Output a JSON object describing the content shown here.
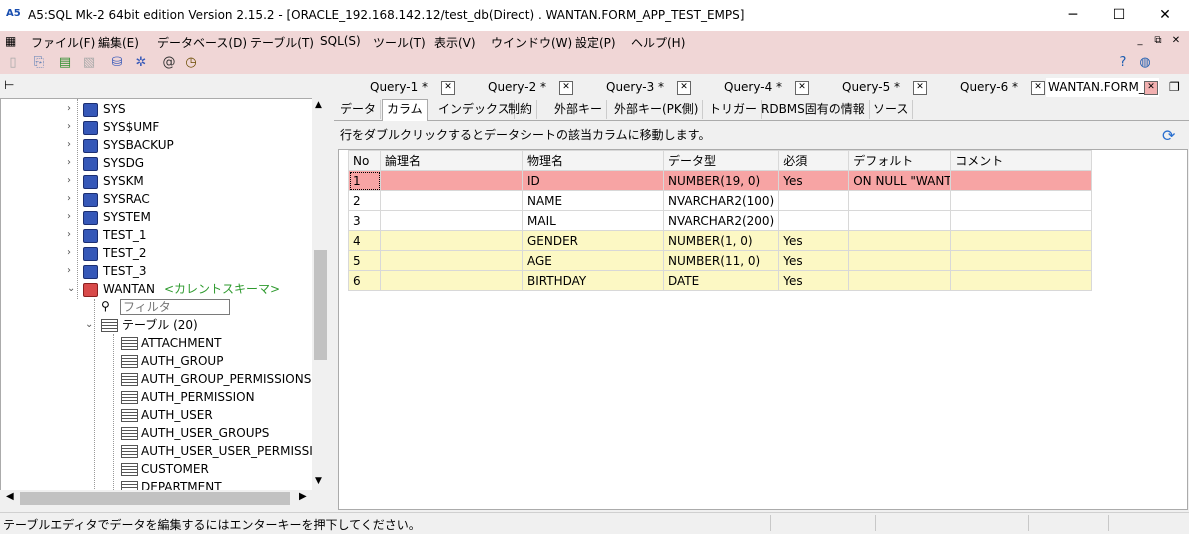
{
  "window": {
    "title": "A5:SQL Mk-2 64bit edition Version 2.15.2 - [ORACLE_192.168.142.12/test_db(Direct) . WANTAN.FORM_APP_TEST_EMPS]",
    "minimize": "─",
    "maximize": "☐",
    "close": "✕"
  },
  "menu": {
    "items": [
      "ファイル(F)",
      "編集(E)",
      "データベース(D)",
      "テーブル(T)",
      "SQL(S)",
      "ツール(T)",
      "表示(V)",
      "ウインドウ(W)",
      "設定(P)",
      "ヘルプ(H)"
    ],
    "mdi_min": "_",
    "mdi_restore": "⧉",
    "mdi_close": "✕"
  },
  "tree": {
    "schemas": [
      "SYS",
      "SYS$UMF",
      "SYSBACKUP",
      "SYSDG",
      "SYSKM",
      "SYSRAC",
      "SYSTEM",
      "TEST_1",
      "TEST_2",
      "TEST_3"
    ],
    "current_schema": "WANTAN",
    "current_tag": "<カレントスキーマ>",
    "filter_placeholder": "フィルタ",
    "tables_label": "テーブル (20)",
    "tables": [
      "ATTACHMENT",
      "AUTH_GROUP",
      "AUTH_GROUP_PERMISSIONS",
      "AUTH_PERMISSION",
      "AUTH_USER",
      "AUTH_USER_GROUPS",
      "AUTH_USER_USER_PERMISSIONS",
      "CUSTOMER",
      "DEPARTMENT"
    ]
  },
  "query_tabs": [
    "Query-1 *",
    "Query-2 *",
    "Query-3 *",
    "Query-4 *",
    "Query-5 *",
    "Query-6 *"
  ],
  "active_doc_tab": "WANTAN.FORM_AI",
  "sub_tabs": [
    "データ",
    "カラム",
    "インデックス",
    "制約",
    "外部キー",
    "外部キー(PK側)",
    "トリガー",
    "RDBMS固有の情報",
    "ソース"
  ],
  "active_sub_tab": "カラム",
  "hint": "行をダブルクリックするとデータシートの該当カラムに移動します。",
  "columns_table": {
    "headers": [
      "No",
      "論理名",
      "物理名",
      "データ型",
      "必須",
      "デフォルト",
      "コメント"
    ],
    "rows": [
      [
        "1",
        "",
        "ID",
        "NUMBER(19, 0)",
        "Yes",
        "ON NULL \"WANTA",
        ""
      ],
      [
        "2",
        "",
        "NAME",
        "NVARCHAR2(100)",
        "",
        "",
        ""
      ],
      [
        "3",
        "",
        "MAIL",
        "NVARCHAR2(200)",
        "",
        "",
        ""
      ],
      [
        "4",
        "",
        "GENDER",
        "NUMBER(1, 0)",
        "Yes",
        "",
        ""
      ],
      [
        "5",
        "",
        "AGE",
        "NUMBER(11, 0)",
        "Yes",
        "",
        ""
      ],
      [
        "6",
        "",
        "BIRTHDAY",
        "DATE",
        "Yes",
        "",
        ""
      ]
    ]
  },
  "status": "テーブルエディタでデータを編集するにはエンターキーを押下してください。",
  "colors": {
    "menubar": "#f0d6d6",
    "pk_row": "#f7a4a4",
    "required_row": "#fcf8c4"
  }
}
